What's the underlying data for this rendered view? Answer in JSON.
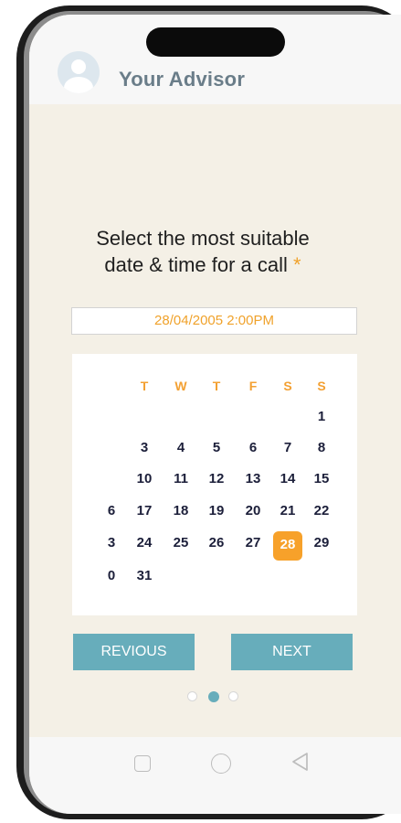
{
  "header": {
    "title": "Your Advisor"
  },
  "prompt": {
    "line1": "Select the most suitable",
    "line2": "date & time for a call",
    "required_mark": "*"
  },
  "datetime": {
    "value": "28/04/2005  2:00PM"
  },
  "calendar": {
    "weekdays": [
      "T",
      "W",
      "T",
      "F",
      "S",
      "S"
    ],
    "rows": [
      [
        "",
        "",
        "",
        "",
        "",
        "1"
      ],
      [
        "",
        "3",
        "4",
        "5",
        "6",
        "7",
        "8"
      ],
      [
        "",
        "10",
        "11",
        "12",
        "13",
        "14",
        "15"
      ],
      [
        "6",
        "17",
        "18",
        "19",
        "20",
        "21",
        "22"
      ],
      [
        "3",
        "24",
        "25",
        "26",
        "27",
        "28",
        "29"
      ],
      [
        "0",
        "31"
      ]
    ],
    "selected_day": "28"
  },
  "navigation": {
    "previous_label": "REVIOUS",
    "next_label": "NEXT"
  },
  "pagination": {
    "active_index": 1,
    "total": 3
  },
  "colors": {
    "accent_orange": "#f7a12a",
    "button_teal": "#67adbb"
  },
  "system_nav": {
    "icons": [
      "square-recent-apps-icon",
      "circle-home-icon",
      "triangle-back-icon"
    ]
  }
}
